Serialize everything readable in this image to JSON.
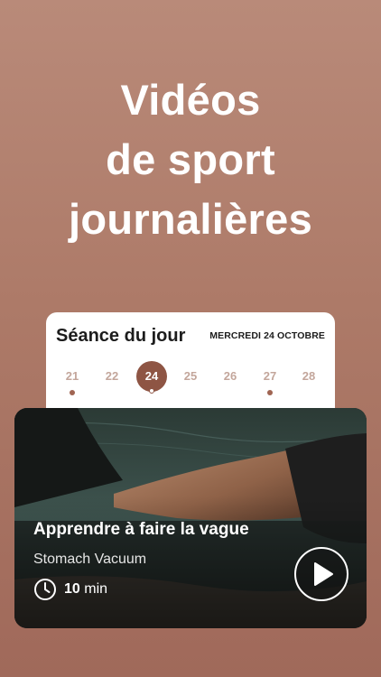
{
  "headline": {
    "line1": "Vidéos",
    "line2": "de sport",
    "line3": "journalières"
  },
  "day_card": {
    "title": "Séance du jour",
    "date": "MERCREDI 24 OCTOBRE",
    "days": [
      {
        "num": "21",
        "has_dot": true,
        "selected": false
      },
      {
        "num": "22",
        "has_dot": false,
        "selected": false
      },
      {
        "num": "24",
        "has_dot": true,
        "selected": true
      },
      {
        "num": "25",
        "has_dot": false,
        "selected": false
      },
      {
        "num": "26",
        "has_dot": false,
        "selected": false
      },
      {
        "num": "27",
        "has_dot": true,
        "selected": false
      },
      {
        "num": "28",
        "has_dot": false,
        "selected": false
      }
    ]
  },
  "video": {
    "title": "Apprendre à faire la vague",
    "subtitle": "Stomach Vacuum",
    "duration_value": "10",
    "duration_unit": "min",
    "clock_icon": "clock-icon",
    "play_icon": "play-icon"
  },
  "colors": {
    "background_top": "#b98a79",
    "background_bottom": "#a0695a",
    "accent": "#8e5544",
    "day_text": "#c3a69b"
  }
}
